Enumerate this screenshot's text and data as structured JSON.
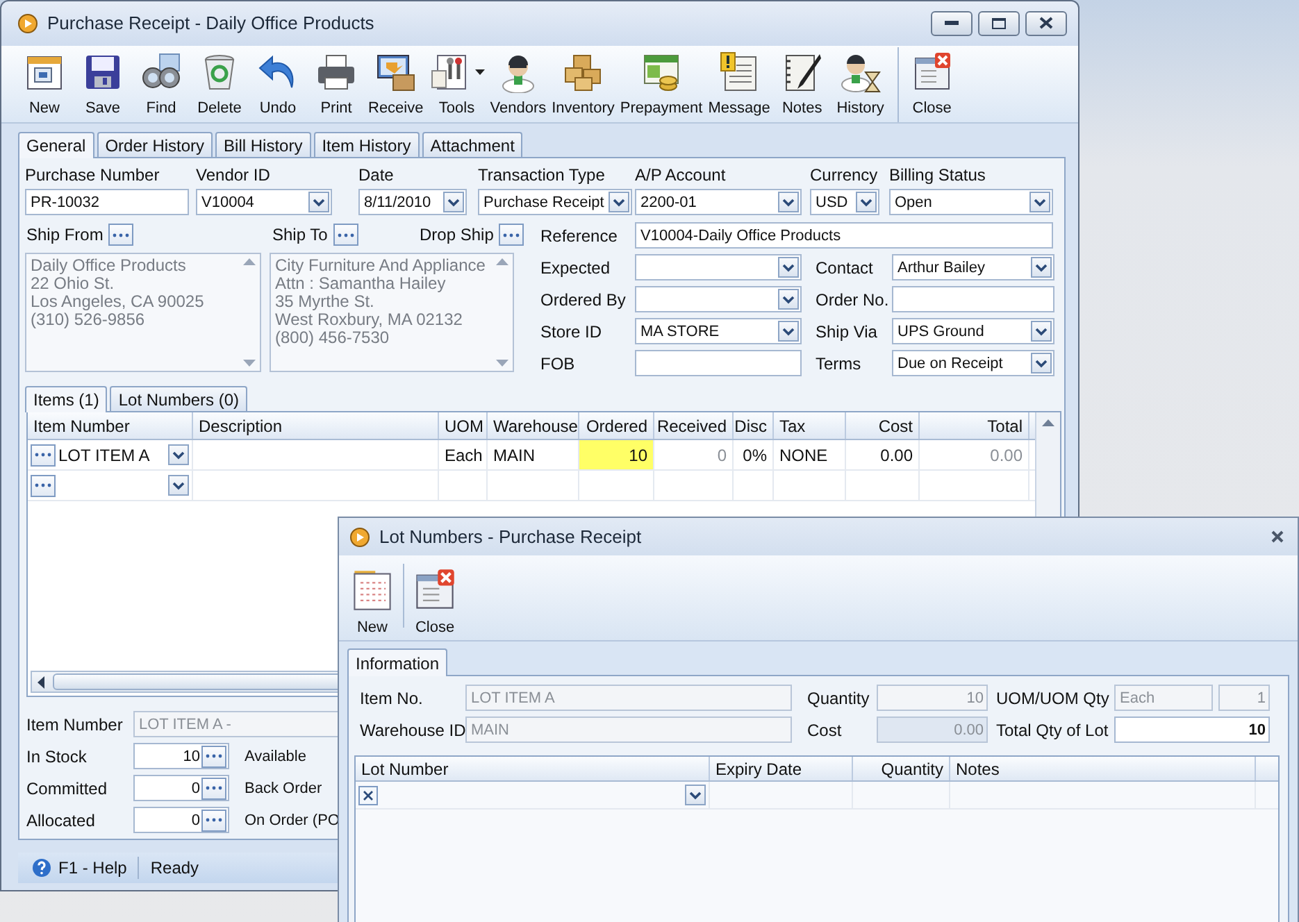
{
  "window": {
    "title": "Purchase Receipt - Daily Office Products"
  },
  "toolbar": [
    {
      "label": "New",
      "dropdown": false,
      "separated": false
    },
    {
      "label": "Save",
      "dropdown": false,
      "separated": false
    },
    {
      "label": "Find",
      "dropdown": false,
      "separated": false
    },
    {
      "label": "Delete",
      "dropdown": false,
      "separated": false
    },
    {
      "label": "Undo",
      "dropdown": false,
      "separated": false
    },
    {
      "label": "Print",
      "dropdown": false,
      "separated": false
    },
    {
      "label": "Receive",
      "dropdown": false,
      "separated": false
    },
    {
      "label": "Tools",
      "dropdown": true,
      "separated": false
    },
    {
      "label": "Vendors",
      "dropdown": false,
      "separated": false
    },
    {
      "label": "Inventory",
      "dropdown": false,
      "separated": false
    },
    {
      "label": "Prepayment",
      "dropdown": false,
      "separated": false
    },
    {
      "label": "Message",
      "dropdown": false,
      "separated": false
    },
    {
      "label": "Notes",
      "dropdown": false,
      "separated": false
    },
    {
      "label": "History",
      "dropdown": false,
      "separated": false
    },
    {
      "label": "Close",
      "dropdown": false,
      "separated": true
    }
  ],
  "tabs": [
    {
      "label": "General",
      "selected": true
    },
    {
      "label": "Order History",
      "selected": false
    },
    {
      "label": "Bill History",
      "selected": false
    },
    {
      "label": "Item History",
      "selected": false
    },
    {
      "label": "Attachment",
      "selected": false
    }
  ],
  "header_fields": [
    {
      "label": "Purchase Number",
      "value": "PR-10032",
      "kind": "text"
    },
    {
      "label": "Vendor ID",
      "value": "V10004",
      "kind": "combo"
    },
    {
      "label": "Date",
      "value": "8/11/2010",
      "kind": "combo"
    },
    {
      "label": "Transaction Type",
      "value": "Purchase Receipt",
      "kind": "combo"
    },
    {
      "label": "A/P Account",
      "value": "2200-01",
      "kind": "combo"
    },
    {
      "label": "Currency",
      "value": "USD",
      "kind": "combo"
    },
    {
      "label": "Billing Status",
      "value": "Open",
      "kind": "combo"
    }
  ],
  "addresses": [
    {
      "label": "Ship From",
      "lines": [
        "Daily Office Products",
        "22 Ohio St.",
        "Los Angeles, CA 90025",
        "(310) 526-9856"
      ]
    },
    {
      "label": "Ship To",
      "lines": [
        "City Furniture And Appliance",
        "Attn : Samantha Hailey",
        "35 Myrthe St.",
        "West Roxbury, MA 02132",
        "(800) 456-7530"
      ]
    }
  ],
  "drop_ship": {
    "label": "Drop Ship"
  },
  "reference": {
    "label": "Reference",
    "value": "V10004-Daily Office Products"
  },
  "detail_rows": [
    {
      "left": {
        "label": "Expected",
        "kind": "combo"
      },
      "right": {
        "label": "Contact",
        "value": "Arthur Bailey",
        "kind": "combo"
      }
    },
    {
      "left": {
        "label": "Ordered By",
        "kind": "combo"
      },
      "right": {
        "label": "Order No.",
        "kind": "text"
      }
    },
    {
      "left": {
        "label": "Store ID",
        "value": "MA STORE",
        "kind": "combo"
      },
      "right": {
        "label": "Ship Via",
        "value": "UPS Ground",
        "kind": "combo"
      }
    },
    {
      "left": {
        "label": "FOB",
        "kind": "text"
      },
      "right": {
        "label": "Terms",
        "value": "Due on Receipt",
        "kind": "combo"
      }
    }
  ],
  "item_tabs": [
    {
      "label": "Items (1)",
      "selected": true
    },
    {
      "label": "Lot Numbers (0)",
      "selected": false
    }
  ],
  "items_grid": {
    "columns": [
      "Item Number",
      "Description",
      "UOM",
      "Warehouse",
      "Ordered",
      "Received",
      "Disc",
      "Tax",
      "Cost",
      "Total"
    ],
    "rows": [
      {
        "kind": "item",
        "cells": [
          {
            "text": "LOT ITEM A",
            "selected": false,
            "disabled": false
          },
          {
            "text": "Each",
            "selected": false,
            "disabled": false
          },
          {
            "text": "MAIN",
            "selected": false,
            "disabled": false
          },
          {
            "text": "10",
            "selected": true,
            "disabled": false
          },
          {
            "text": "0",
            "selected": false,
            "disabled": true
          },
          {
            "text": "0%",
            "selected": false,
            "disabled": false
          },
          {
            "text": "NONE",
            "selected": false,
            "disabled": false
          },
          {
            "text": "0.00",
            "selected": false,
            "disabled": false
          },
          {
            "text": "0.00",
            "selected": false,
            "disabled": true
          }
        ]
      },
      {
        "kind": "new"
      }
    ]
  },
  "inventory": {
    "item_number": {
      "label": "Item Number",
      "value": "LOT ITEM A -",
      "disabled": true
    },
    "stats": [
      {
        "label": "In Stock",
        "value": "10",
        "side_label": "Available"
      },
      {
        "label": "Committed",
        "value": "0",
        "side_label": "Back Order"
      },
      {
        "label": "Allocated",
        "value": "0",
        "side_label": "On Order (PO"
      }
    ]
  },
  "status_bar": {
    "help": "F1 - Help",
    "status": "Ready"
  },
  "dialog": {
    "title": "Lot Numbers - Purchase Receipt",
    "toolbar": [
      {
        "label": "New"
      },
      {
        "label": "Close"
      }
    ],
    "tabs": [
      {
        "label": "Information",
        "selected": true
      }
    ],
    "item_no": {
      "label": "Item No.",
      "value": "LOT ITEM A",
      "disabled": true
    },
    "warehouse_id": {
      "label": "Warehouse ID",
      "value": "MAIN",
      "disabled": true
    },
    "quantity": {
      "label": "Quantity",
      "value": "10",
      "disabled": true
    },
    "cost": {
      "label": "Cost",
      "value": "0.00",
      "disabled": true
    },
    "uom": {
      "label": "UOM/UOM Qty",
      "value": "Each",
      "qty": "1",
      "disabled": true
    },
    "total": {
      "label": "Total Qty of Lot",
      "value": "10",
      "disabled": false
    },
    "grid": {
      "columns": [
        "Lot Number",
        "Expiry Date",
        "Quantity",
        "Notes"
      ],
      "rows": [
        {
          "kind": "new"
        }
      ]
    }
  }
}
